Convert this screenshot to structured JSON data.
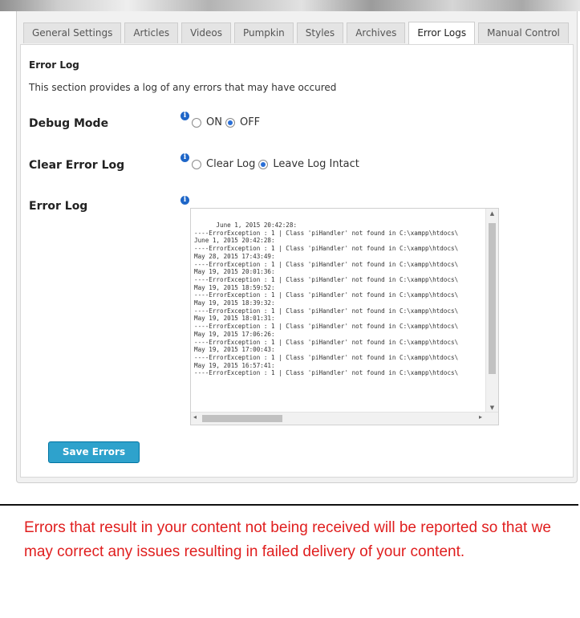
{
  "tabs": [
    {
      "label": "General Settings"
    },
    {
      "label": "Articles"
    },
    {
      "label": "Videos"
    },
    {
      "label": "Pumpkin"
    },
    {
      "label": "Styles"
    },
    {
      "label": "Archives"
    },
    {
      "label": "Error Logs"
    },
    {
      "label": "Manual Control"
    }
  ],
  "active_tab": "Error Logs",
  "section": {
    "title": "Error Log",
    "description": "This section provides a log of any errors that may have occured"
  },
  "debug_mode": {
    "label": "Debug Mode",
    "options": [
      "ON",
      "OFF"
    ],
    "selected": "OFF"
  },
  "clear_error_log": {
    "label": "Clear Error Log",
    "options": [
      "Clear Log",
      "Leave Log Intact"
    ],
    "selected": "Leave Log Intact"
  },
  "error_log": {
    "label": "Error Log",
    "lines": [
      "      June 1, 2015 20:42:28:",
      "----ErrorException : 1 | Class 'piHandler' not found in C:\\xampp\\htdocs\\",
      "June 1, 2015 20:42:28:",
      "----ErrorException : 1 | Class 'piHandler' not found in C:\\xampp\\htdocs\\",
      "May 28, 2015 17:43:49:",
      "----ErrorException : 1 | Class 'piHandler' not found in C:\\xampp\\htdocs\\",
      "May 19, 2015 20:01:36:",
      "----ErrorException : 1 | Class 'piHandler' not found in C:\\xampp\\htdocs\\",
      "May 19, 2015 18:59:52:",
      "----ErrorException : 1 | Class 'piHandler' not found in C:\\xampp\\htdocs\\",
      "May 19, 2015 18:39:32:",
      "----ErrorException : 1 | Class 'piHandler' not found in C:\\xampp\\htdocs\\",
      "May 19, 2015 18:01:31:",
      "----ErrorException : 1 | Class 'piHandler' not found in C:\\xampp\\htdocs\\",
      "May 19, 2015 17:06:26:",
      "----ErrorException : 1 | Class 'piHandler' not found in C:\\xampp\\htdocs\\",
      "May 19, 2015 17:00:43:",
      "----ErrorException : 1 | Class 'piHandler' not found in C:\\xampp\\htdocs\\",
      "May 19, 2015 16:57:41:",
      "----ErrorException : 1 | Class 'piHandler' not found in C:\\xampp\\htdocs\\"
    ]
  },
  "save_button": "Save Errors",
  "note": "Errors that result in your content not being received will be reported so that we may correct any issues resulting in failed delivery of your content.",
  "colors": {
    "accent": "#2ea2cc",
    "info_icon": "#1e66c8",
    "note_text": "#e01e1e"
  },
  "icons": {
    "info": "info-icon",
    "scroll_up": "arrow-up-icon",
    "scroll_down": "arrow-down-icon",
    "scroll_left": "arrow-left-icon",
    "scroll_right": "arrow-right-icon"
  }
}
